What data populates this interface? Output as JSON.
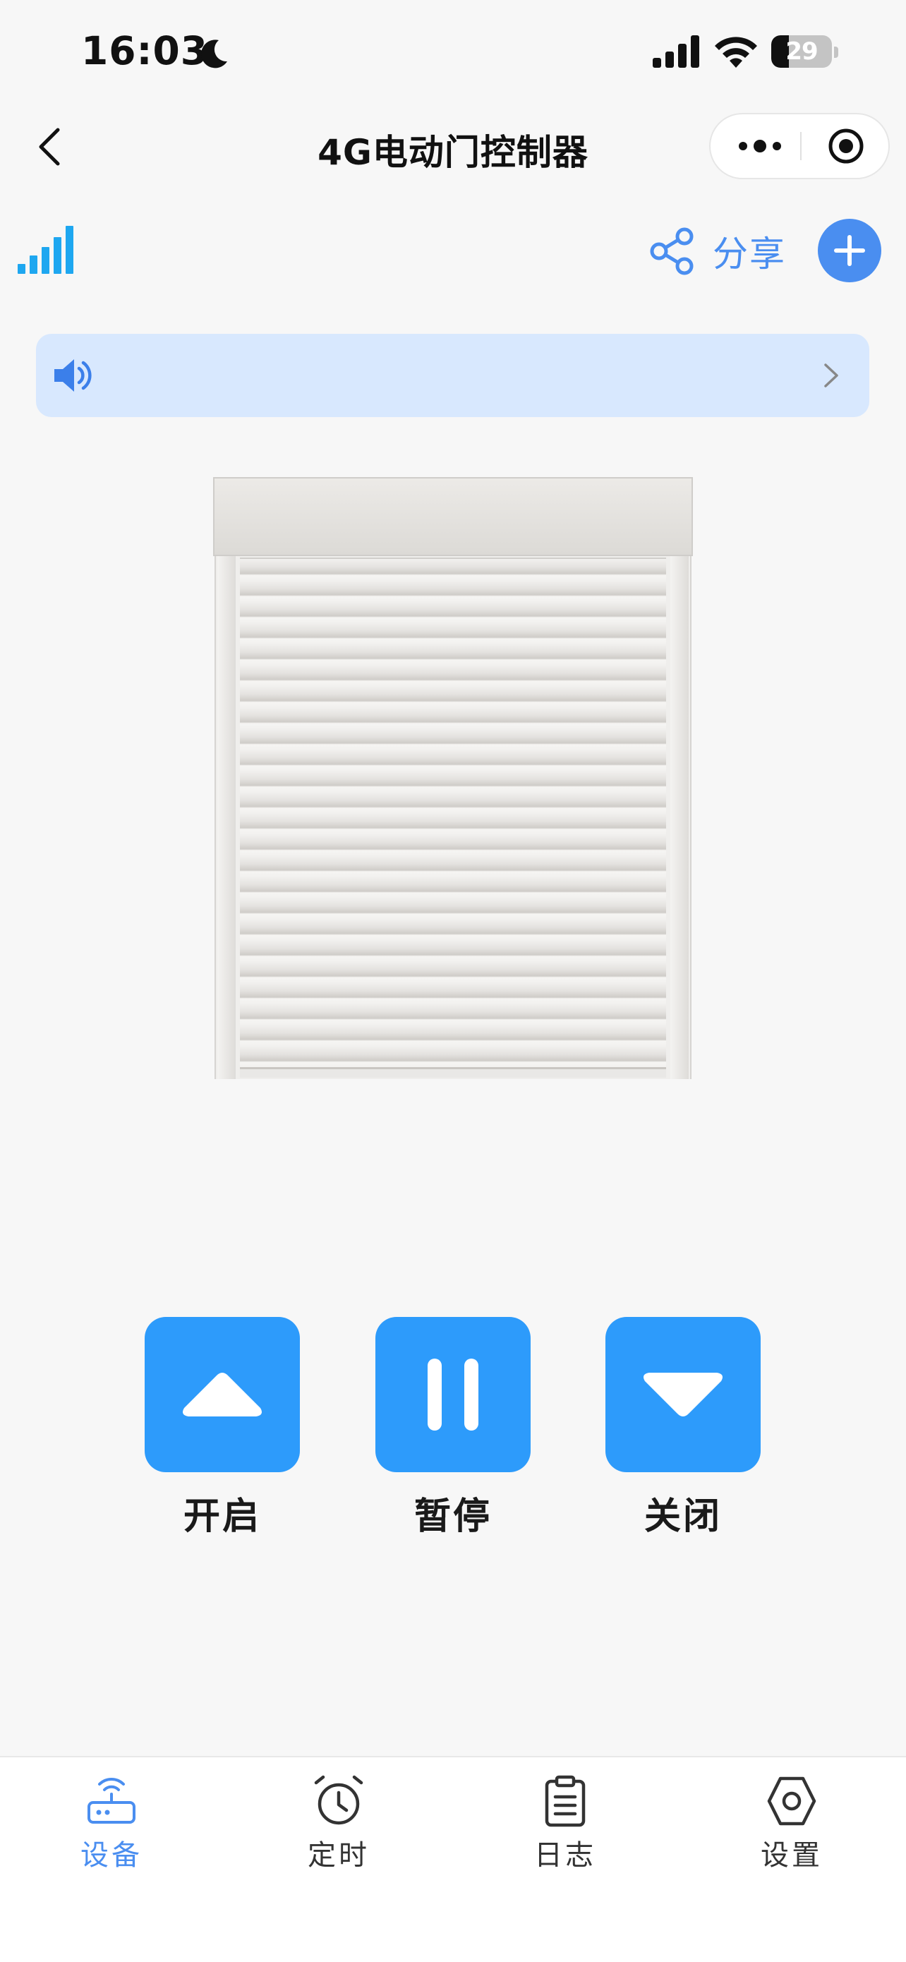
{
  "status_bar": {
    "time": "16:03",
    "battery": "29",
    "battery_level": 0.29
  },
  "nav": {
    "title": "4G电动门控制器"
  },
  "toolbar": {
    "share_label": "分享"
  },
  "notice": {
    "text": ""
  },
  "controls": {
    "open_label": "开启",
    "pause_label": "暂停",
    "close_label": "关闭"
  },
  "tabbar": {
    "tabs": [
      {
        "label": "设备",
        "icon": "router-icon",
        "active": true
      },
      {
        "label": "定时",
        "icon": "alarm-clock-icon",
        "active": false
      },
      {
        "label": "日志",
        "icon": "clipboard-icon",
        "active": false
      },
      {
        "label": "设置",
        "icon": "hexagon-settings-icon",
        "active": false
      }
    ]
  },
  "colors": {
    "accent": "#4a8ef0",
    "control_button": "#2d9bfb",
    "notice_bg": "#d8e8fe",
    "signal": "#1ea7f0",
    "page_bg": "#f7f7f7"
  }
}
